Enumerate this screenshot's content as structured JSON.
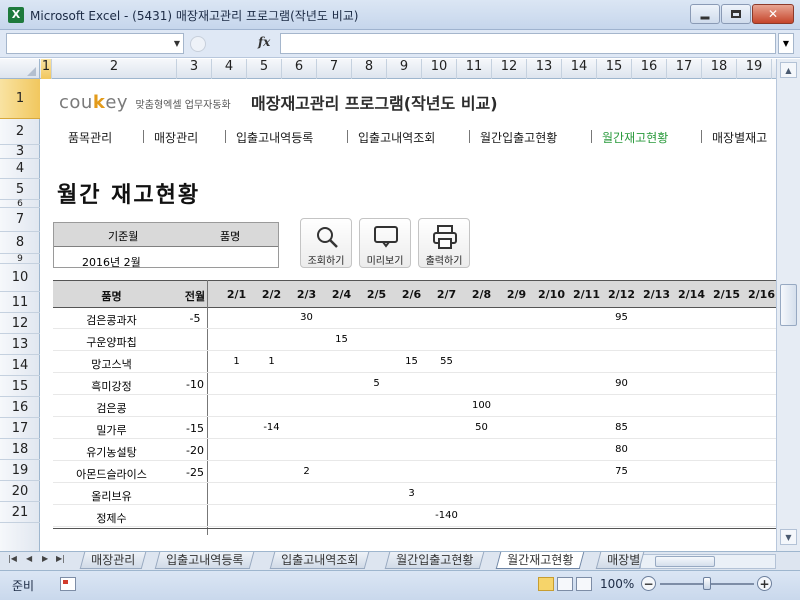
{
  "window": {
    "app_icon": "X",
    "title": "Microsoft Excel - (5431) 매장재고관리 프로그램(작년도 비교)"
  },
  "formula_bar": {
    "name_box": "",
    "fx": "fx",
    "content": ""
  },
  "columns": [
    "1",
    "2",
    "3",
    "4",
    "5",
    "6",
    "7",
    "8",
    "9",
    "10",
    "11",
    "12",
    "13",
    "14",
    "15",
    "16",
    "17",
    "18",
    "19"
  ],
  "rows": [
    "1",
    "2",
    "3",
    "4",
    "5",
    "6",
    "7",
    "8",
    "9",
    "10",
    "11",
    "12",
    "13",
    "14",
    "15",
    "16",
    "17",
    "18",
    "19",
    "20",
    "21"
  ],
  "header": {
    "logo_brand": "coukey",
    "logo_sub": "맞춤형엑셀 업무자동화",
    "app_title": "매장재고관리 프로그램(작년도 비교)"
  },
  "menu": [
    {
      "label": "품목관리",
      "current": false
    },
    {
      "label": "매장관리",
      "current": false
    },
    {
      "label": "입출고내역등록",
      "current": false
    },
    {
      "label": "입출고내역조회",
      "current": false
    },
    {
      "label": "월간입출고현황",
      "current": false
    },
    {
      "label": "월간재고현황",
      "current": true
    },
    {
      "label": "매장별재고",
      "current": false
    }
  ],
  "page_heading": "월간 재고현황",
  "filter": {
    "month_label": "기준월",
    "item_label": "품명",
    "month_value": "2016년 2월",
    "item_value": ""
  },
  "buttons": {
    "search": "조회하기",
    "preview": "미리보기",
    "print": "출력하기"
  },
  "grid": {
    "name_header": "품명",
    "prev_header": "전월",
    "days": [
      "2/1",
      "2/2",
      "2/3",
      "2/4",
      "2/5",
      "2/6",
      "2/7",
      "2/8",
      "2/9",
      "2/10",
      "2/11",
      "2/12",
      "2/13",
      "2/14",
      "2/15",
      "2/16"
    ],
    "rows": [
      {
        "name": "검은콩과자",
        "prev": "-5",
        "values": [
          "",
          "",
          "30",
          "",
          "",
          "",
          "",
          "",
          "",
          "",
          "",
          "95",
          "",
          "",
          "",
          ""
        ]
      },
      {
        "name": "구운양파칩",
        "prev": "",
        "values": [
          "",
          "",
          "",
          "15",
          "",
          "",
          "",
          "",
          "",
          "",
          "",
          "",
          "",
          "",
          "",
          ""
        ]
      },
      {
        "name": "망고스낵",
        "prev": "",
        "values": [
          "1",
          "1",
          "",
          "",
          "",
          "15",
          "55",
          "",
          "",
          "",
          "",
          "",
          "",
          "",
          "",
          ""
        ]
      },
      {
        "name": "흑미강정",
        "prev": "-10",
        "values": [
          "",
          "",
          "",
          "",
          "5",
          "",
          "",
          "",
          "",
          "",
          "",
          "90",
          "",
          "",
          "",
          ""
        ]
      },
      {
        "name": "검은콩",
        "prev": "",
        "values": [
          "",
          "",
          "",
          "",
          "",
          "",
          "",
          "100",
          "",
          "",
          "",
          "",
          "",
          "",
          "",
          ""
        ]
      },
      {
        "name": "밀가루",
        "prev": "-15",
        "values": [
          "",
          "-14",
          "",
          "",
          "",
          "",
          "",
          "50",
          "",
          "",
          "",
          "85",
          "",
          "",
          "",
          ""
        ]
      },
      {
        "name": "유기농설탕",
        "prev": "-20",
        "values": [
          "",
          "",
          "",
          "",
          "",
          "",
          "",
          "",
          "",
          "",
          "",
          "80",
          "",
          "",
          "",
          ""
        ]
      },
      {
        "name": "아몬드슬라이스",
        "prev": "-25",
        "values": [
          "",
          "",
          "2",
          "",
          "",
          "",
          "",
          "",
          "",
          "",
          "",
          "75",
          "",
          "",
          "",
          ""
        ]
      },
      {
        "name": "올리브유",
        "prev": "",
        "values": [
          "",
          "",
          "",
          "",
          "",
          "3",
          "",
          "",
          "",
          "",
          "",
          "",
          "",
          "",
          "",
          ""
        ]
      },
      {
        "name": "정제수",
        "prev": "",
        "values": [
          "",
          "",
          "",
          "",
          "",
          "",
          "-140",
          "",
          "",
          "",
          "",
          "",
          "",
          "",
          "",
          ""
        ]
      }
    ]
  },
  "sheet_tabs": [
    {
      "label": "매장관리",
      "active": false
    },
    {
      "label": "입출고내역등록",
      "active": false
    },
    {
      "label": "입출고내역조회",
      "active": false
    },
    {
      "label": "월간입출고현황",
      "active": false
    },
    {
      "label": "월간재고현황",
      "active": true
    },
    {
      "label": "매장별",
      "active": false
    }
  ],
  "status": {
    "ready": "준비",
    "zoom": "100%",
    "zoom_minus": "−",
    "zoom_plus": "+"
  },
  "icons": {
    "app": "excel-icon",
    "search": "magnifier-icon",
    "preview": "monitor-icon",
    "print": "printer-icon"
  },
  "colors": {
    "current_menu": "#2a9a3c",
    "logo_accent": "#e39b1b",
    "active_header": "#f1c75e",
    "grid_header_bg": "#d9d9d9"
  }
}
